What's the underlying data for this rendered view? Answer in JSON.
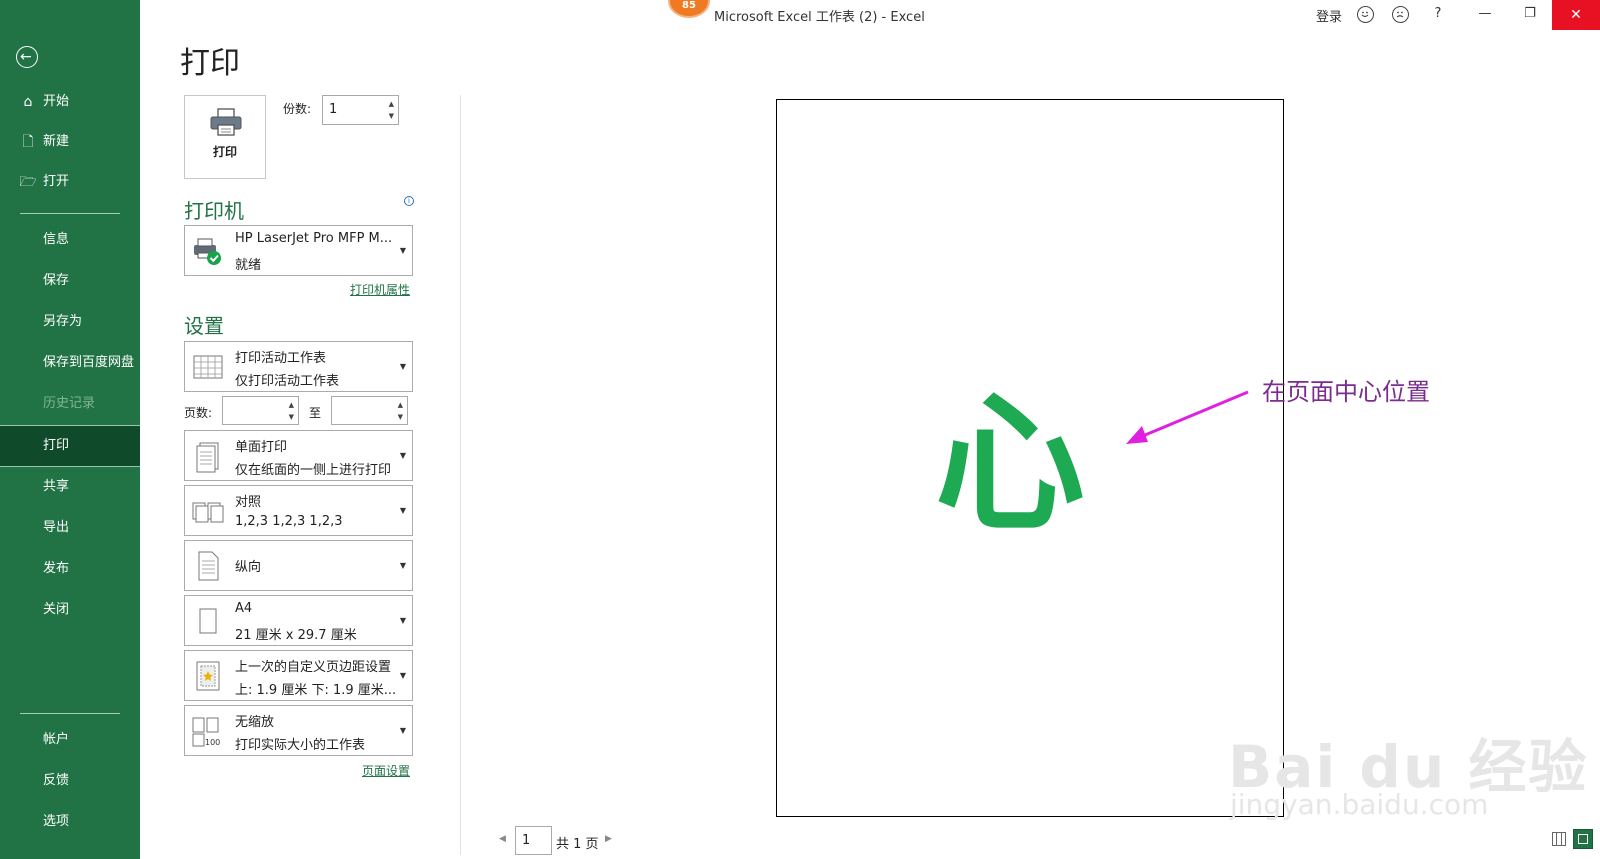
{
  "window": {
    "badge": "85",
    "title": "Microsoft Excel 工作表 (2)  -  Excel",
    "signin": "登录",
    "help": "?",
    "minimize": "—",
    "restore": "❐",
    "close": "✕"
  },
  "sidebar": {
    "back_icon": "←",
    "items": [
      {
        "label": "开始",
        "icon": "⌂"
      },
      {
        "label": "新建",
        "icon": "🗋"
      },
      {
        "label": "打开",
        "icon": "🗁"
      },
      {
        "label": "信息"
      },
      {
        "label": "保存"
      },
      {
        "label": "另存为"
      },
      {
        "label": "保存到百度网盘"
      },
      {
        "label": "历史记录"
      },
      {
        "label": "打印"
      },
      {
        "label": "共享"
      },
      {
        "label": "导出"
      },
      {
        "label": "发布"
      },
      {
        "label": "关闭"
      },
      {
        "label": "帐户"
      },
      {
        "label": "反馈"
      },
      {
        "label": "选项"
      }
    ]
  },
  "print": {
    "title": "打印",
    "button_label": "打印",
    "copies_label": "份数:",
    "copies_value": "1",
    "printer_heading": "打印机",
    "printer_name": "HP LaserJet Pro MFP M...",
    "printer_status": "就绪",
    "printer_properties": "打印机属性",
    "settings_heading": "设置",
    "settings": [
      {
        "line1": "打印活动工作表",
        "line2": "仅打印活动工作表"
      },
      {
        "line1": "单面打印",
        "line2": "仅在纸面的一侧上进行打印"
      },
      {
        "line1": "对照",
        "line2": "1,2,3    1,2,3    1,2,3"
      },
      {
        "line1": "纵向",
        "line2": ""
      },
      {
        "line1": "A4",
        "line2": "21 厘米 x 29.7 厘米"
      },
      {
        "line1": "上一次的自定义页边距设置",
        "line2": "上: 1.9 厘米 下: 1.9 厘米..."
      },
      {
        "line1": "无缩放",
        "line2": "打印实际大小的工作表"
      }
    ],
    "pages_label": "页数:",
    "pages_to": "至",
    "page_setup": "页面设置"
  },
  "preview": {
    "content": "心",
    "annotation": "在页面中心位置",
    "current_page": "1",
    "total_pages": "共 1 页"
  },
  "watermark": {
    "line1": "Bai du 经验",
    "line2": "jingyan.baidu.com"
  },
  "colors": {
    "sidebar": "#217346",
    "accent": "#217346",
    "preview_text": "#1eaa52",
    "annotation": "#7b2c8e",
    "arrow": "#e020e0"
  }
}
